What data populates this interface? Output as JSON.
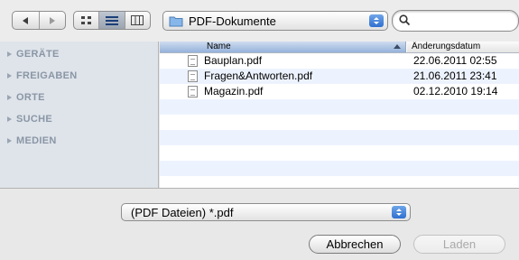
{
  "toolbar": {
    "back_label": "back",
    "forward_label": "forward",
    "view_modes": [
      "icon-view",
      "list-view",
      "column-view"
    ],
    "location": "PDF-Dokumente",
    "search": {
      "value": "",
      "placeholder": ""
    }
  },
  "sidebar": {
    "items": [
      {
        "label": "GERÄTE"
      },
      {
        "label": "FREIGABEN"
      },
      {
        "label": "ORTE"
      },
      {
        "label": "SUCHE"
      },
      {
        "label": "MEDIEN"
      }
    ]
  },
  "file_list": {
    "columns": {
      "name": "Name",
      "modified": "Änderungsdatum"
    },
    "rows": [
      {
        "name": "Bauplan.pdf",
        "modified": "22.06.2011 02:55"
      },
      {
        "name": "Fragen&Antworten.pdf",
        "modified": "21.06.2011 23:41"
      },
      {
        "name": "Magazin.pdf",
        "modified": "02.12.2010 19:14"
      }
    ]
  },
  "filter": {
    "selected": "(PDF Dateien) *.pdf"
  },
  "buttons": {
    "cancel": "Abbrechen",
    "load": "Laden"
  },
  "colors": {
    "accent": "#3a7bd5",
    "header_selected": "#a9c1e2",
    "sidebar_bg": "#dfe4ea",
    "row_alt": "#edf3fe"
  }
}
